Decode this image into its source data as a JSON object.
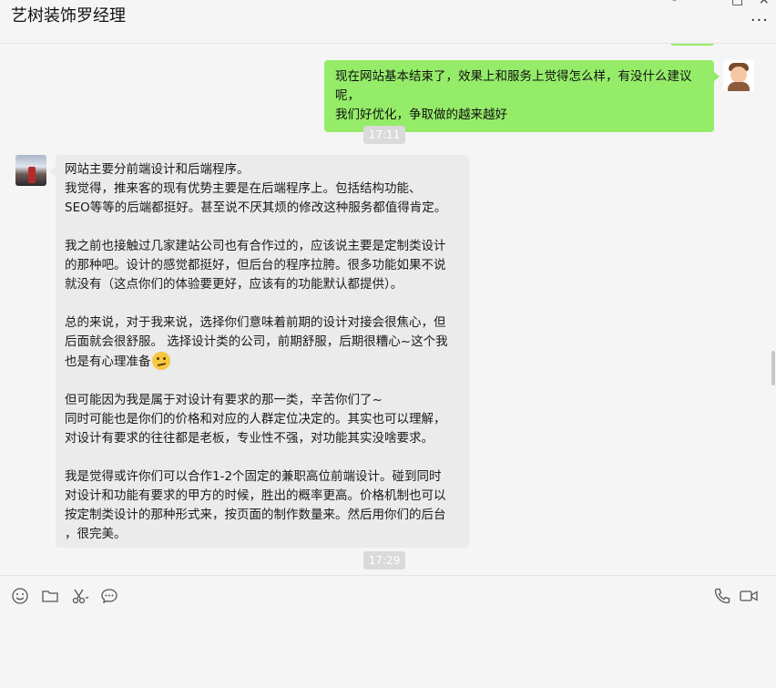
{
  "window": {
    "title": "艺树装饰罗经理",
    "more_label": "···",
    "controls": {
      "minimize": "-",
      "maximize": "□",
      "close": "×"
    }
  },
  "messages": [
    {
      "id": "out-1",
      "direction": "out",
      "lines": [
        "现在网站基本结束了，效果上和服务上觉得怎么样，有没什么建议呢，",
        "我们好优化，争取做的越来越好"
      ]
    },
    {
      "id": "time-1",
      "type": "timestamp",
      "text": "17:11"
    },
    {
      "id": "in-1",
      "direction": "in",
      "paragraphs": [
        [
          "网站主要分前端设计和后端程序。",
          "我觉得，推来客的现有优势主要是在后端程序上。包括结构功能、",
          "SEO等等的后端都挺好。甚至说不厌其烦的修改这种服务都值得肯定。"
        ],
        [
          "我之前也接触过几家建站公司也有合作过的，应该说主要是定制类设计",
          "的那种吧。设计的感觉都挺好，但后台的程序拉胯。很多功能如果不说",
          "就没有（这点你们的体验要更好，应该有的功能默认都提供）。"
        ],
        [
          "总的来说，对于我来说，选择你们意味着前期的设计对接会很焦心，但",
          "后面就会很舒服。 选择设计类的公司，前期舒服，后期很糟心~这个我",
          "也是有心理准备"
        ],
        [
          "但可能因为我是属于对设计有要求的那一类，辛苦你们了~",
          "同时可能也是你们的价格和对应的人群定位决定的。其实也可以理解，",
          "对设计有要求的往往都是老板，专业性不强，对功能其实没啥要求。"
        ],
        [
          "我是觉得或许你们可以合作1-2个固定的兼职高位前端设计。碰到同时",
          "对设计和功能有要求的甲方的时候，胜出的概率更高。价格机制也可以",
          "按定制类设计的那种形式来，按页面的制作数量来。然后用你们的后台",
          "，很完美。"
        ]
      ],
      "emoji_after_paragraph": 2,
      "emoji_name": "thinking-face-emoji"
    },
    {
      "id": "time-2",
      "type": "timestamp",
      "text": "17:29"
    }
  ],
  "toolbar": {
    "left_icons": [
      "smiley-icon",
      "folder-icon",
      "scissors-icon",
      "chat-bubble-icon"
    ],
    "right_icons": [
      "phone-icon",
      "video-icon"
    ]
  },
  "colors": {
    "outgoing_bubble": "#95ec69",
    "incoming_bubble": "#ebebeb",
    "background": "#f5f5f5",
    "timestamp_pill": "#dadada"
  }
}
